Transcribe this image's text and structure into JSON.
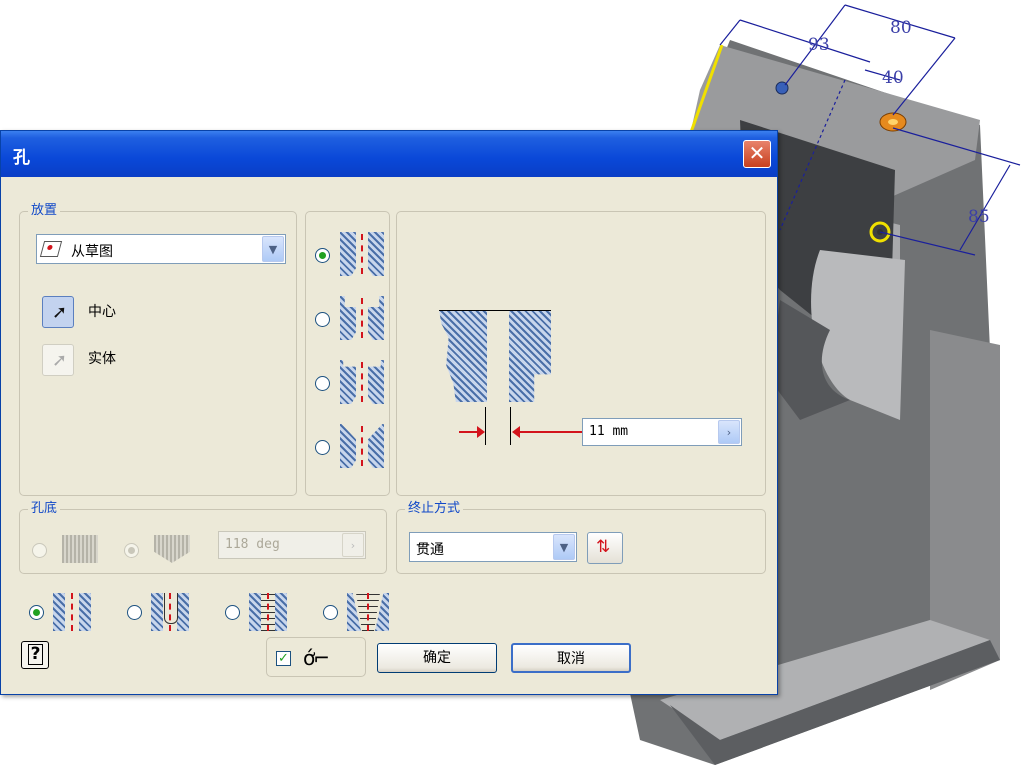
{
  "drawing": {
    "dimensions": [
      "80",
      "93",
      "40",
      "85"
    ]
  },
  "dialog": {
    "title": "孔",
    "close_glyph": "✕",
    "placement": {
      "group_title": "放置",
      "placement_type": "从草图",
      "center_label": "中心",
      "solid_label": "实体"
    },
    "hole_types": {
      "selected_index": 0,
      "options": [
        "drilled",
        "counterbore",
        "spotface",
        "countersink"
      ]
    },
    "preview": {
      "diameter_value": "11 mm"
    },
    "drill_point": {
      "group_title": "孔底",
      "angle_value": "118 deg"
    },
    "termination": {
      "group_title": "终止方式",
      "value": "贯通"
    },
    "thread_types": {
      "selected_index": 0
    },
    "buttons": {
      "ok": "确定",
      "cancel": "取消",
      "help_glyph": "?"
    },
    "preview_checkbox": {
      "checked": true
    },
    "icons": {
      "help": "help-icon",
      "glasses": "glasses-preview-icon",
      "flip": "flip-direction-icon",
      "cursor": "pointer-cursor-icon",
      "sketch": "sketch-plane-icon"
    },
    "colors": {
      "titlebar": "#0a48d8",
      "accent_red": "#d3141c",
      "group_title": "#1048c8"
    }
  }
}
